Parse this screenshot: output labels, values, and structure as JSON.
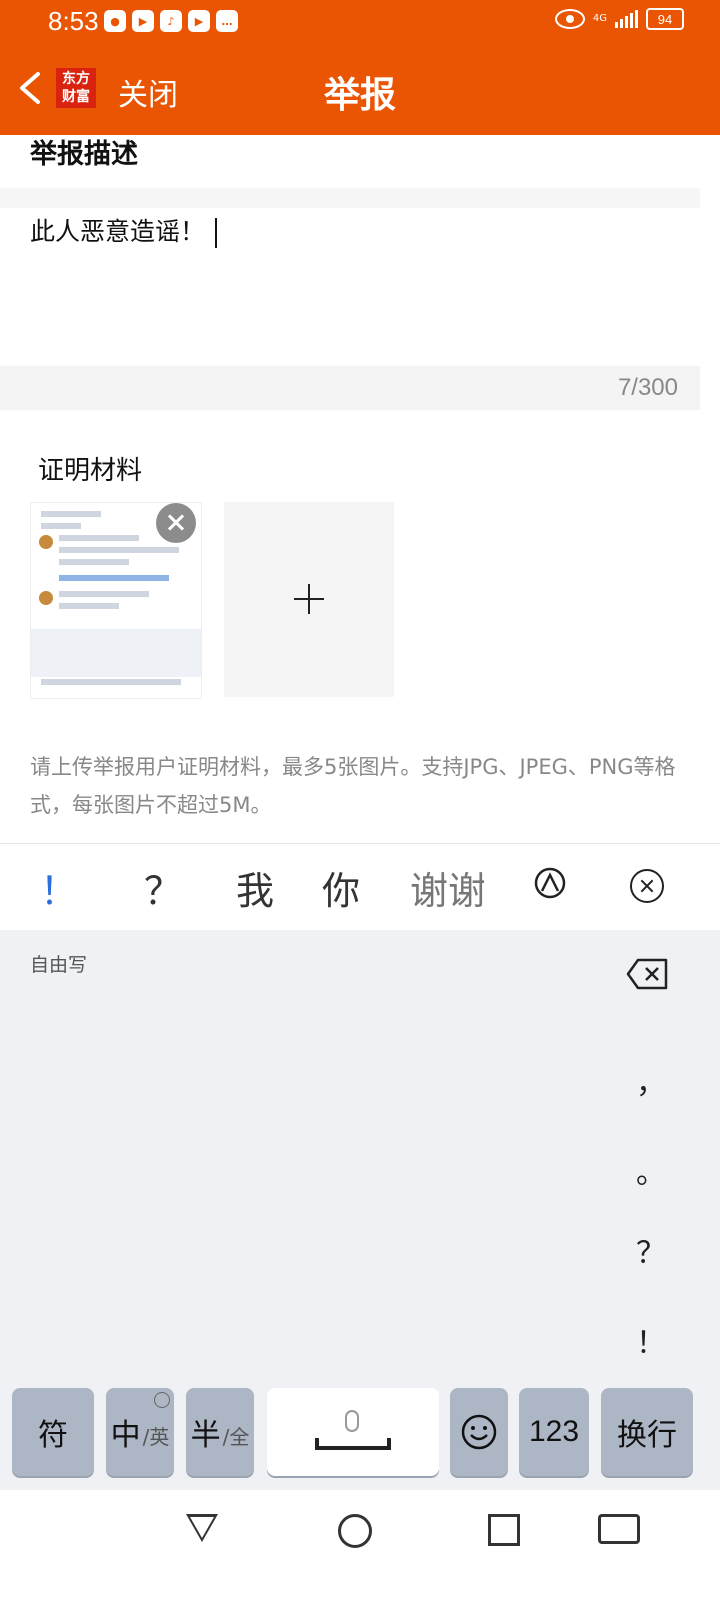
{
  "status_bar": {
    "time": "8:53",
    "battery": "94",
    "network": "4G"
  },
  "header": {
    "close_label": "关闭",
    "title": "举报",
    "logo_text_line1": "东方",
    "logo_text_line2": "财富"
  },
  "report": {
    "description_title": "举报描述",
    "description_value": "此人恶意造谣！",
    "char_counter": "7/300",
    "materials_title": "证明材料",
    "hint": "请上传举报用户证明材料，最多5张图片。支持JPG、JPEG、PNG等格式，每张图片不超过5M。"
  },
  "keyboard": {
    "suggestions": [
      "！",
      "？",
      "我",
      "你",
      "谢谢"
    ],
    "handwrite_label": "自由写",
    "side_punct": [
      "，",
      "。",
      "？",
      "！"
    ],
    "keys": {
      "symbols": "符",
      "chinese": "中",
      "chinese_sub": "/英",
      "half": "半",
      "half_sub": "/全",
      "numbers": "123",
      "enter": "换行"
    }
  },
  "colors": {
    "accent": "#ea5504",
    "keyboard_bg": "#eff1f5",
    "key": "#adb6c4"
  }
}
